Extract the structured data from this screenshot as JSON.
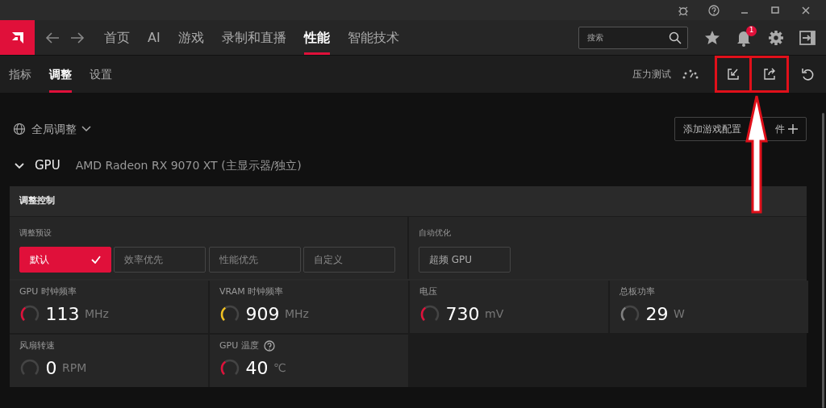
{
  "nav": {
    "tabs": [
      {
        "label": "首页",
        "selected": false
      },
      {
        "label": "AI",
        "selected": false
      },
      {
        "label": "游戏",
        "selected": false
      },
      {
        "label": "录制和直播",
        "selected": false
      },
      {
        "label": "性能",
        "selected": true
      },
      {
        "label": "智能技术",
        "selected": false
      }
    ],
    "search": {
      "placeholder": "搜索"
    },
    "notification_count": "1"
  },
  "sub_nav": {
    "tabs": [
      {
        "label": "指标",
        "selected": false
      },
      {
        "label": "调整",
        "selected": true
      },
      {
        "label": "设置",
        "selected": false
      }
    ],
    "stress_test": "压力测试"
  },
  "profile": {
    "label": "全局调整",
    "add_button": [
      "添加游戏配置",
      "件"
    ]
  },
  "gpu": {
    "label": "GPU",
    "name": "AMD Radeon RX 9070 XT (主显示器/独立)",
    "expanded": true
  },
  "tuning": {
    "title": "调整控制",
    "preset_label": "调整预设",
    "presets": [
      {
        "label": "默认",
        "selected": true
      },
      {
        "label": "效率优先",
        "selected": false
      },
      {
        "label": "性能优先",
        "selected": false
      },
      {
        "label": "自定义",
        "selected": false
      }
    ],
    "auto_label": "自动优化",
    "auto_button": "超频 GPU"
  },
  "metrics": [
    {
      "name": "GPU 时钟频率",
      "value": "113",
      "unit": "MHz",
      "color": "#e0103a",
      "help": false
    },
    {
      "name": "VRAM 时钟频率",
      "value": "909",
      "unit": "MHz",
      "color": "#f0c020",
      "help": false
    },
    {
      "name": "电压",
      "value": "730",
      "unit": "mV",
      "color": "#e0103a",
      "help": false
    },
    {
      "name": "总板功率",
      "value": "29",
      "unit": "W",
      "color": "#808080",
      "help": false
    },
    {
      "name": "风扇转速",
      "value": "0",
      "unit": "RPM",
      "help": false
    },
    {
      "name": "GPU 温度",
      "value": "40",
      "unit": "℃",
      "color": "#e0103a",
      "help": true
    }
  ]
}
